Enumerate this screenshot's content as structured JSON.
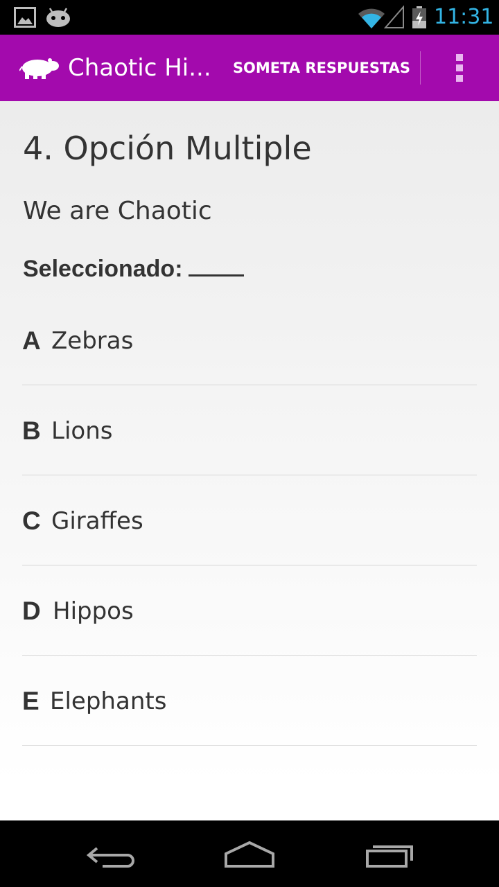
{
  "status_bar": {
    "time": "11:31",
    "time_color": "#33b5e5",
    "icons": [
      "gallery-icon",
      "android-icon",
      "wifi-icon",
      "signal-icon",
      "battery-charging-icon"
    ]
  },
  "action_bar": {
    "title": "Chaotic Hi...",
    "submit_label": "SOMETA RESPUESTAS",
    "background_color": "#a30aad",
    "logo_icon": "hippo-icon",
    "overflow_icon": "overflow-menu-icon"
  },
  "question": {
    "title": "4. Opción Multiple",
    "text": "We are Chaotic",
    "selected_label": "Seleccionado:",
    "selected_value": "",
    "options": [
      {
        "letter": "A",
        "text": "Zebras"
      },
      {
        "letter": "B",
        "text": "Lions"
      },
      {
        "letter": "C",
        "text": "Giraffes"
      },
      {
        "letter": "D",
        "text": "Hippos"
      },
      {
        "letter": "E",
        "text": "Elephants"
      }
    ]
  },
  "nav_bar": {
    "buttons": [
      "back-icon",
      "home-icon",
      "recents-icon"
    ]
  }
}
